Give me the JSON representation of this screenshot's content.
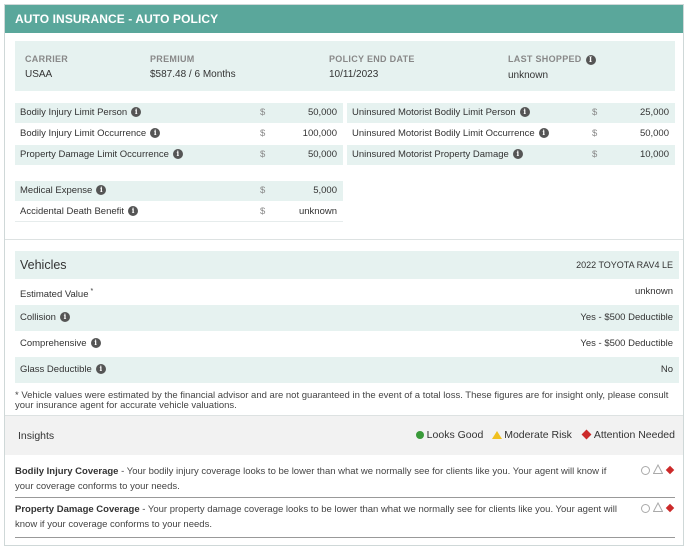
{
  "header": {
    "title": "AUTO INSURANCE - AUTO POLICY"
  },
  "summary": {
    "carrier": {
      "label": "CARRIER",
      "value": "USAA"
    },
    "premium": {
      "label": "PREMIUM",
      "value": "$587.48 / 6 Months"
    },
    "policy_end": {
      "label": "POLICY END DATE",
      "value": "10/11/2023"
    },
    "last_shopped": {
      "label": "LAST SHOPPED",
      "value": "unknown"
    }
  },
  "currency": "$",
  "info_glyph": "i",
  "coverage_left": [
    {
      "label": "Bodily Injury Limit Person",
      "value": "50,000"
    },
    {
      "label": "Bodily Injury Limit Occurrence",
      "value": "100,000"
    },
    {
      "label": "Property Damage Limit Occurrence",
      "value": "50,000"
    }
  ],
  "coverage_right": [
    {
      "label": "Uninsured Motorist Bodily Limit Person",
      "value": "25,000"
    },
    {
      "label": "Uninsured Motorist Bodily Limit Occurrence",
      "value": "50,000"
    },
    {
      "label": "Uninsured Motorist Property Damage",
      "value": "10,000"
    }
  ],
  "coverage_extra": [
    {
      "label": "Medical Expense",
      "value": "5,000"
    },
    {
      "label": "Accidental Death Benefit",
      "value": "unknown"
    }
  ],
  "vehicles": {
    "title": "Vehicles",
    "vehicle_name": "2022 TOYOTA RAV4 LE",
    "rows": [
      {
        "label": "Estimated Value",
        "suffix": "*",
        "value": "unknown"
      },
      {
        "label": "Collision",
        "value": "Yes - $500 Deductible"
      },
      {
        "label": "Comprehensive",
        "value": "Yes - $500 Deductible"
      },
      {
        "label": "Glass Deductible",
        "value": "No"
      }
    ],
    "note": "* Vehicle values were estimated by the financial advisor and are not guaranteed in the event of a total loss. These figures are for insight only, please consult your insurance agent for accurate vehicle valuations."
  },
  "insights": {
    "title": "Insights",
    "legend": {
      "good": "Looks Good",
      "moderate": "Moderate Risk",
      "attention": "Attention Needed"
    },
    "items": [
      {
        "title": "Bodily Injury Coverage",
        "text": " - Your bodily injury coverage looks to be lower than what we normally see for clients like you. Your agent will know if your coverage conforms to your needs."
      },
      {
        "title": "Property Damage Coverage",
        "text": " - Your property damage coverage looks to be lower than what we normally see for clients like you. Your agent will know if your coverage conforms to your needs."
      }
    ]
  },
  "colors": {
    "header": "#5aa79b",
    "shade": "#e6f2f0",
    "good": "#3a9a3a",
    "moderate": "#f0c020",
    "attention": "#cc2a2a"
  }
}
